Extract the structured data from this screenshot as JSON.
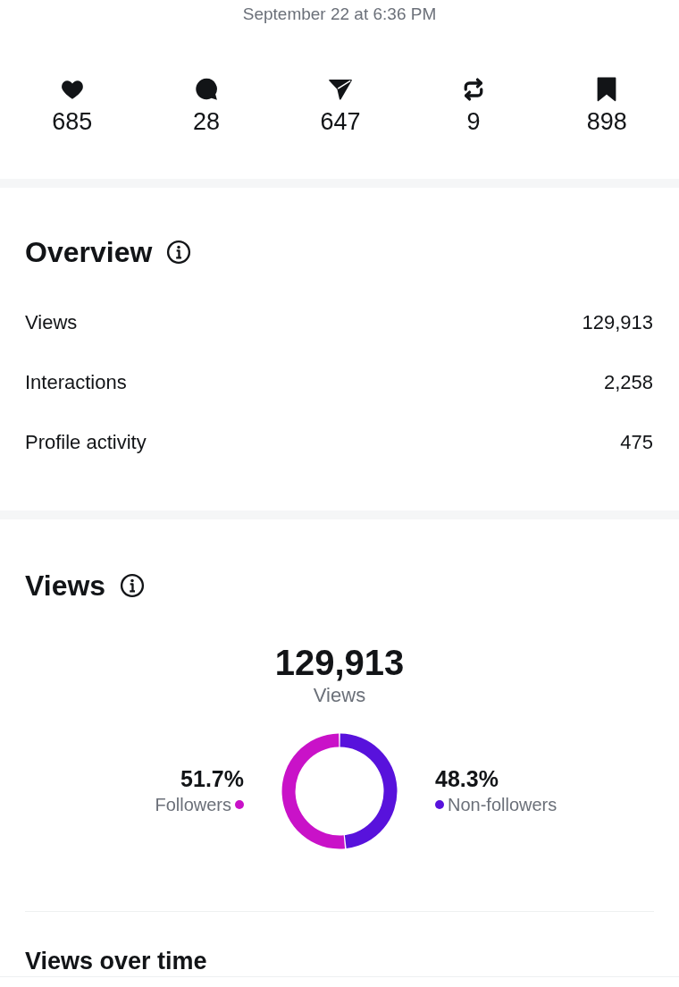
{
  "timestamp": "September 22 at 6:36 PM",
  "engagement": [
    {
      "count": "685"
    },
    {
      "count": "28"
    },
    {
      "count": "647"
    },
    {
      "count": "9"
    },
    {
      "count": "898"
    }
  ],
  "overview": {
    "title": "Overview",
    "rows": [
      {
        "label": "Views",
        "value": "129,913"
      },
      {
        "label": "Interactions",
        "value": "2,258"
      },
      {
        "label": "Profile activity",
        "value": "475"
      }
    ]
  },
  "views": {
    "title": "Views",
    "total": "129,913",
    "total_label": "Views",
    "breakdown": [
      {
        "share": "51.7%",
        "color": "#c912c8"
      },
      {
        "share": "48.3%",
        "color": "#5812dc"
      }
    ],
    "chart_data": {
      "type": "donut",
      "categories": [
        "Followers",
        "Non-followers"
      ],
      "values": [
        51.7,
        48.3
      ]
    }
  },
  "views_over_time": {
    "title": "Views over time"
  }
}
